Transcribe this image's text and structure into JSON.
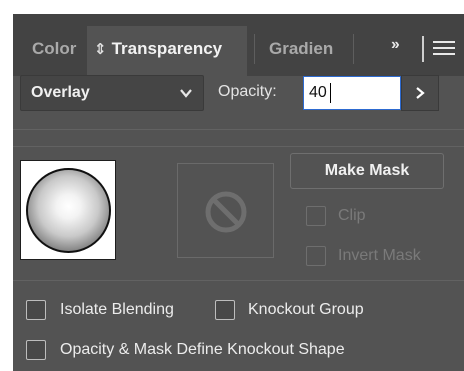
{
  "tabs": {
    "color": "Color",
    "transparency": "Transparency",
    "gradient": "Gradien",
    "more": "››"
  },
  "blend_mode": {
    "selected": "Overlay"
  },
  "opacity": {
    "label": "Opacity:",
    "value": "40"
  },
  "mask": {
    "make_mask_label": "Make Mask"
  },
  "options": {
    "clip": "Clip",
    "invert_mask": "Invert Mask",
    "isolate_blending": "Isolate Blending",
    "knockout_group": "Knockout Group",
    "opacity_mask_knockout": "Opacity & Mask Define Knockout Shape"
  }
}
